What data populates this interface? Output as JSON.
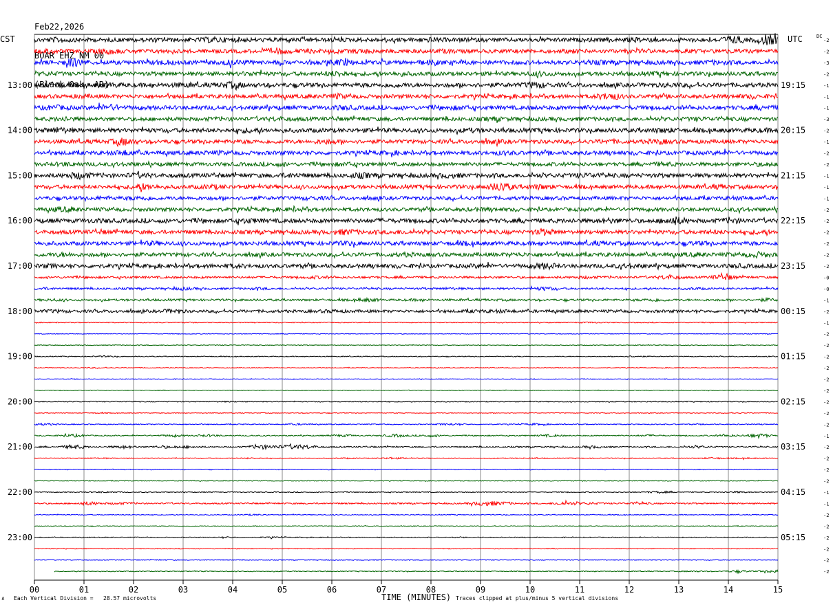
{
  "header": {
    "date": "Feb22,2026",
    "station": "BOAR EHZ NM 00",
    "location": "(Black Oak, AR)"
  },
  "left_zone": "CST",
  "right_zone": "UTC",
  "dc_label": "DC",
  "footer": {
    "scale_marker": "∧",
    "scale_text": "Each Vertical Division =   28.57 microvolts",
    "clip_text": "Traces clipped at plus/minus 5 vertical divisions"
  },
  "colors": {
    "trace_cycle": [
      "#000000",
      "#ff0000",
      "#0000ff",
      "#006400"
    ],
    "grid": "#888888",
    "frame": "#000000"
  },
  "chart_data": {
    "type": "line",
    "title": "",
    "xlabel": "TIME (MINUTES)",
    "ylabel": "",
    "xlim": [
      0,
      15
    ],
    "x_ticks": [
      "00",
      "01",
      "02",
      "03",
      "04",
      "05",
      "06",
      "07",
      "08",
      "09",
      "10",
      "11",
      "12",
      "13",
      "14",
      "15"
    ],
    "rows_per_hour": 4,
    "row_count": 48,
    "left_hour_labels": [
      "13:00",
      "14:00",
      "15:00",
      "16:00",
      "17:00",
      "18:00",
      "19:00",
      "20:00",
      "21:00",
      "22:00",
      "23:00"
    ],
    "right_hour_labels": [
      "19:15",
      "20:15",
      "21:15",
      "22:15",
      "23:15",
      "00:15",
      "01:15",
      "02:15",
      "03:15",
      "04:15",
      "05:15"
    ],
    "dc_offsets": [
      "-2",
      "-2",
      "-3",
      "-2",
      "-1",
      "-1",
      "-1",
      "-3",
      "-2",
      "-1",
      "-2",
      "-2",
      "-1",
      "-1",
      "-1",
      "-2",
      "-2",
      "-2",
      "-2",
      "-2",
      "-2",
      "-0",
      "-0",
      "-1",
      "-2",
      "-1",
      "-2",
      "-2",
      "-2",
      "-2",
      "-2",
      "-2",
      "-2",
      "-2",
      "-2",
      "-1",
      "-2",
      "-2",
      "-2",
      "-2",
      "-1",
      "-1",
      "-2",
      "-2",
      "-2",
      "-2",
      "-2",
      "-2"
    ],
    "traces": [
      {
        "row": 0,
        "amplitude": 3.0,
        "events": [
          [
            0.5,
            1.5
          ],
          [
            3.6,
            1.6
          ],
          [
            4.1,
            1.3
          ],
          [
            8.0,
            1.3
          ],
          [
            12.2,
            1.3
          ],
          [
            14.1,
            2.2
          ],
          [
            14.8,
            2.8
          ]
        ]
      },
      {
        "row": 1,
        "amplitude": 2.8,
        "events": [
          [
            0.3,
            1.4
          ],
          [
            1.5,
            1.8
          ],
          [
            4.9,
            1.9
          ],
          [
            5.5,
            1.3
          ],
          [
            6.6,
            1.4
          ],
          [
            8.3,
            1.3
          ],
          [
            10.9,
            1.3
          ],
          [
            14.1,
            1.3
          ]
        ]
      },
      {
        "row": 2,
        "amplitude": 3.0,
        "events": [
          [
            0.8,
            2.2
          ],
          [
            2.6,
            1.5
          ],
          [
            4.0,
            1.6
          ],
          [
            6.2,
            1.9
          ],
          [
            8.0,
            1.4
          ],
          [
            11.4,
            1.3
          ],
          [
            13.7,
            1.3
          ]
        ]
      },
      {
        "row": 3,
        "amplitude": 2.8,
        "events": [
          [
            0.3,
            1.3
          ],
          [
            4.4,
            1.4
          ],
          [
            6.1,
            1.8
          ],
          [
            7.4,
            1.3
          ],
          [
            10.2,
            1.5
          ],
          [
            12.6,
            1.3
          ]
        ]
      },
      {
        "row": 4,
        "amplitude": 3.0,
        "events": [
          [
            0.4,
            1.7
          ],
          [
            1.5,
            1.5
          ],
          [
            3.0,
            1.3
          ],
          [
            4.0,
            1.9
          ],
          [
            7.2,
            1.4
          ],
          [
            10.1,
            1.9
          ],
          [
            12.8,
            1.3
          ]
        ]
      },
      {
        "row": 5,
        "amplitude": 2.8,
        "events": [
          [
            1.0,
            1.3
          ],
          [
            6.1,
            1.5
          ],
          [
            11.6,
            2.2
          ],
          [
            14.4,
            1.3
          ]
        ]
      },
      {
        "row": 6,
        "amplitude": 3.0,
        "events": [
          [
            0.4,
            1.5
          ],
          [
            1.5,
            1.9
          ],
          [
            6.2,
            1.4
          ],
          [
            8.6,
            1.3
          ],
          [
            11.2,
            1.3
          ],
          [
            14.8,
            1.3
          ]
        ]
      },
      {
        "row": 7,
        "amplitude": 2.8,
        "events": [
          [
            0.6,
            1.3
          ],
          [
            4.9,
            1.4
          ],
          [
            9.3,
            1.3
          ],
          [
            13.4,
            1.3
          ]
        ]
      },
      {
        "row": 8,
        "amplitude": 3.0,
        "events": [
          [
            0.5,
            1.8
          ],
          [
            4.3,
            1.5
          ],
          [
            8.8,
            1.3
          ],
          [
            12.7,
            1.5
          ],
          [
            14.7,
            1.3
          ]
        ]
      },
      {
        "row": 9,
        "amplitude": 2.8,
        "events": [
          [
            1.8,
            2.2
          ],
          [
            5.9,
            1.5
          ],
          [
            9.3,
            1.4
          ],
          [
            11.6,
            1.4
          ],
          [
            12.6,
            1.6
          ]
        ]
      },
      {
        "row": 10,
        "amplitude": 2.8,
        "events": [
          [
            1.8,
            1.8
          ],
          [
            3.6,
            1.4
          ],
          [
            7.2,
            1.3
          ],
          [
            9.5,
            1.4
          ],
          [
            13.9,
            1.3
          ]
        ]
      },
      {
        "row": 11,
        "amplitude": 2.6,
        "events": [
          [
            0.6,
            1.5
          ],
          [
            1.8,
            1.3
          ],
          [
            4.9,
            1.3
          ],
          [
            6.3,
            1.4
          ],
          [
            12.7,
            1.5
          ],
          [
            14.7,
            1.4
          ]
        ]
      },
      {
        "row": 12,
        "amplitude": 3.0,
        "events": [
          [
            0.9,
            2.0
          ],
          [
            2.1,
            1.5
          ],
          [
            5.2,
            1.5
          ],
          [
            6.6,
            1.6
          ],
          [
            8.4,
            1.4
          ],
          [
            11.1,
            1.4
          ]
        ]
      },
      {
        "row": 13,
        "amplitude": 2.8,
        "events": [
          [
            2.2,
            2.0
          ],
          [
            3.6,
            1.5
          ],
          [
            9.4,
            2.5
          ],
          [
            10.2,
            1.6
          ],
          [
            13.8,
            1.3
          ]
        ]
      },
      {
        "row": 14,
        "amplitude": 2.6,
        "events": [
          [
            1.4,
            1.3
          ],
          [
            2.2,
            1.5
          ],
          [
            5.6,
            1.3
          ],
          [
            14.2,
            1.3
          ]
        ]
      },
      {
        "row": 15,
        "amplitude": 2.6,
        "events": [
          [
            0.6,
            1.8
          ],
          [
            5.3,
            1.4
          ],
          [
            9.0,
            1.3
          ],
          [
            14.3,
            1.3
          ]
        ]
      },
      {
        "row": 16,
        "amplitude": 3.0,
        "events": [
          [
            1.3,
            1.3
          ],
          [
            4.3,
            1.5
          ],
          [
            7.0,
            1.3
          ],
          [
            11.6,
            1.5
          ],
          [
            12.9,
            2.3
          ],
          [
            14.1,
            1.5
          ]
        ]
      },
      {
        "row": 17,
        "amplitude": 2.8,
        "events": [
          [
            1.3,
            1.3
          ],
          [
            6.3,
            1.8
          ],
          [
            7.4,
            1.3
          ],
          [
            10.3,
            1.8
          ],
          [
            13.7,
            1.3
          ],
          [
            14.6,
            1.4
          ]
        ]
      },
      {
        "row": 18,
        "amplitude": 2.8,
        "events": [
          [
            2.4,
            1.4
          ],
          [
            6.3,
            1.5
          ],
          [
            8.7,
            1.3
          ],
          [
            11.3,
            1.3
          ],
          [
            13.4,
            1.3
          ]
        ]
      },
      {
        "row": 19,
        "amplitude": 2.8,
        "events": [
          [
            0.6,
            1.4
          ],
          [
            7.5,
            1.3
          ],
          [
            9.7,
            1.3
          ],
          [
            13.3,
            1.3
          ],
          [
            14.6,
            1.8
          ]
        ]
      },
      {
        "row": 20,
        "amplitude": 2.8,
        "events": [
          [
            0.3,
            1.3
          ],
          [
            4.0,
            1.3
          ],
          [
            9.0,
            1.4
          ],
          [
            10.3,
            2.0
          ],
          [
            12.0,
            1.5
          ],
          [
            14.2,
            1.3
          ]
        ]
      },
      {
        "row": 21,
        "amplitude": 1.6,
        "events": [
          [
            5.7,
            1.6
          ],
          [
            11.1,
            1.6
          ],
          [
            12.8,
            2.5
          ],
          [
            13.9,
            3.0
          ]
        ]
      },
      {
        "row": 22,
        "amplitude": 1.4,
        "events": [
          [
            0.2,
            1.5
          ],
          [
            3.0,
            1.8
          ],
          [
            4.5,
            1.5
          ],
          [
            8.4,
            1.5
          ],
          [
            10.3,
            2.2
          ],
          [
            13.3,
            1.5
          ]
        ]
      },
      {
        "row": 23,
        "amplitude": 1.5,
        "events": [
          [
            0.4,
            1.5
          ],
          [
            6.7,
            2.0
          ],
          [
            7.7,
            1.3
          ],
          [
            12.5,
            1.8
          ],
          [
            14.8,
            1.8
          ]
        ]
      },
      {
        "row": 24,
        "amplitude": 2.0,
        "events": [
          [
            0.4,
            1.5
          ],
          [
            2.8,
            1.8
          ],
          [
            6.0,
            1.5
          ],
          [
            8.9,
            1.4
          ],
          [
            9.4,
            1.5
          ]
        ]
      },
      {
        "row": 25,
        "amplitude": 0.6,
        "events": [
          [
            11.2,
            2.0
          ]
        ]
      },
      {
        "row": 26,
        "amplitude": 0.5,
        "events": []
      },
      {
        "row": 27,
        "amplitude": 0.5,
        "events": []
      },
      {
        "row": 28,
        "amplitude": 0.6,
        "events": [
          [
            1.4,
            2.0
          ],
          [
            12.1,
            2.0
          ]
        ]
      },
      {
        "row": 29,
        "amplitude": 0.5,
        "events": [
          [
            1.2,
            1.8
          ]
        ]
      },
      {
        "row": 30,
        "amplitude": 0.5,
        "events": []
      },
      {
        "row": 31,
        "amplitude": 0.5,
        "events": []
      },
      {
        "row": 32,
        "amplitude": 0.6,
        "events": [
          [
            3.9,
            1.6
          ]
        ]
      },
      {
        "row": 33,
        "amplitude": 0.5,
        "events": [
          [
            1.3,
            1.6
          ],
          [
            14.2,
            1.5
          ]
        ]
      },
      {
        "row": 34,
        "amplitude": 0.7,
        "events": [
          [
            0.2,
            2.5
          ],
          [
            5.3,
            2.0
          ],
          [
            8.4,
            2.5
          ],
          [
            10.1,
            2.2
          ]
        ]
      },
      {
        "row": 35,
        "amplitude": 0.8,
        "events": [
          [
            0.8,
            3.0
          ],
          [
            2.8,
            2.5
          ],
          [
            3.5,
            2.5
          ],
          [
            6.2,
            2.5
          ],
          [
            7.3,
            3.0
          ],
          [
            8.0,
            2.5
          ],
          [
            10.4,
            2.5
          ],
          [
            12.4,
            2.0
          ],
          [
            14.0,
            2.5
          ],
          [
            14.6,
            4.5
          ]
        ]
      },
      {
        "row": 36,
        "amplitude": 1.0,
        "events": [
          [
            0.8,
            3.5
          ],
          [
            1.8,
            2.5
          ],
          [
            2.6,
            2.2
          ],
          [
            3.1,
            2.0
          ],
          [
            4.6,
            3.5
          ],
          [
            5.1,
            3.0
          ],
          [
            5.5,
            3.0
          ],
          [
            11.3,
            2.0
          ],
          [
            13.4,
            2.0
          ]
        ]
      },
      {
        "row": 37,
        "amplitude": 0.6,
        "events": [
          [
            1.3,
            1.8
          ],
          [
            4.4,
            1.8
          ],
          [
            6.3,
            1.8
          ],
          [
            7.2,
            2.5
          ],
          [
            10.0,
            1.8
          ],
          [
            13.7,
            2.5
          ],
          [
            14.3,
            1.8
          ]
        ]
      },
      {
        "row": 38,
        "amplitude": 0.5,
        "events": [
          [
            6.0,
            1.5
          ]
        ]
      },
      {
        "row": 39,
        "amplitude": 0.5,
        "events": []
      },
      {
        "row": 40,
        "amplitude": 0.6,
        "events": [
          [
            1.4,
            2.0
          ],
          [
            12.6,
            3.0
          ],
          [
            14.2,
            2.2
          ]
        ]
      },
      {
        "row": 41,
        "amplitude": 1.0,
        "events": [
          [
            1.1,
            3.0
          ],
          [
            1.7,
            2.0
          ],
          [
            9.0,
            3.0
          ],
          [
            9.4,
            3.0
          ],
          [
            10.7,
            3.0
          ],
          [
            11.2,
            2.0
          ],
          [
            12.2,
            2.0
          ]
        ]
      },
      {
        "row": 42,
        "amplitude": 0.6,
        "events": [
          [
            4.4,
            2.0
          ]
        ]
      },
      {
        "row": 43,
        "amplitude": 0.5,
        "events": []
      },
      {
        "row": 44,
        "amplitude": 0.6,
        "events": [
          [
            3.9,
            2.0
          ],
          [
            4.8,
            2.0
          ]
        ]
      },
      {
        "row": 45,
        "amplitude": 0.5,
        "events": [
          [
            1.7,
            1.5
          ]
        ]
      },
      {
        "row": 46,
        "amplitude": 0.5,
        "events": [
          [
            2.6,
            1.5
          ]
        ]
      },
      {
        "row": 47,
        "amplitude": 0.6,
        "x_start": 0.4,
        "events": [
          [
            13.3,
            2.0
          ],
          [
            14.2,
            3.0
          ],
          [
            14.9,
            4.0
          ]
        ]
      }
    ]
  }
}
